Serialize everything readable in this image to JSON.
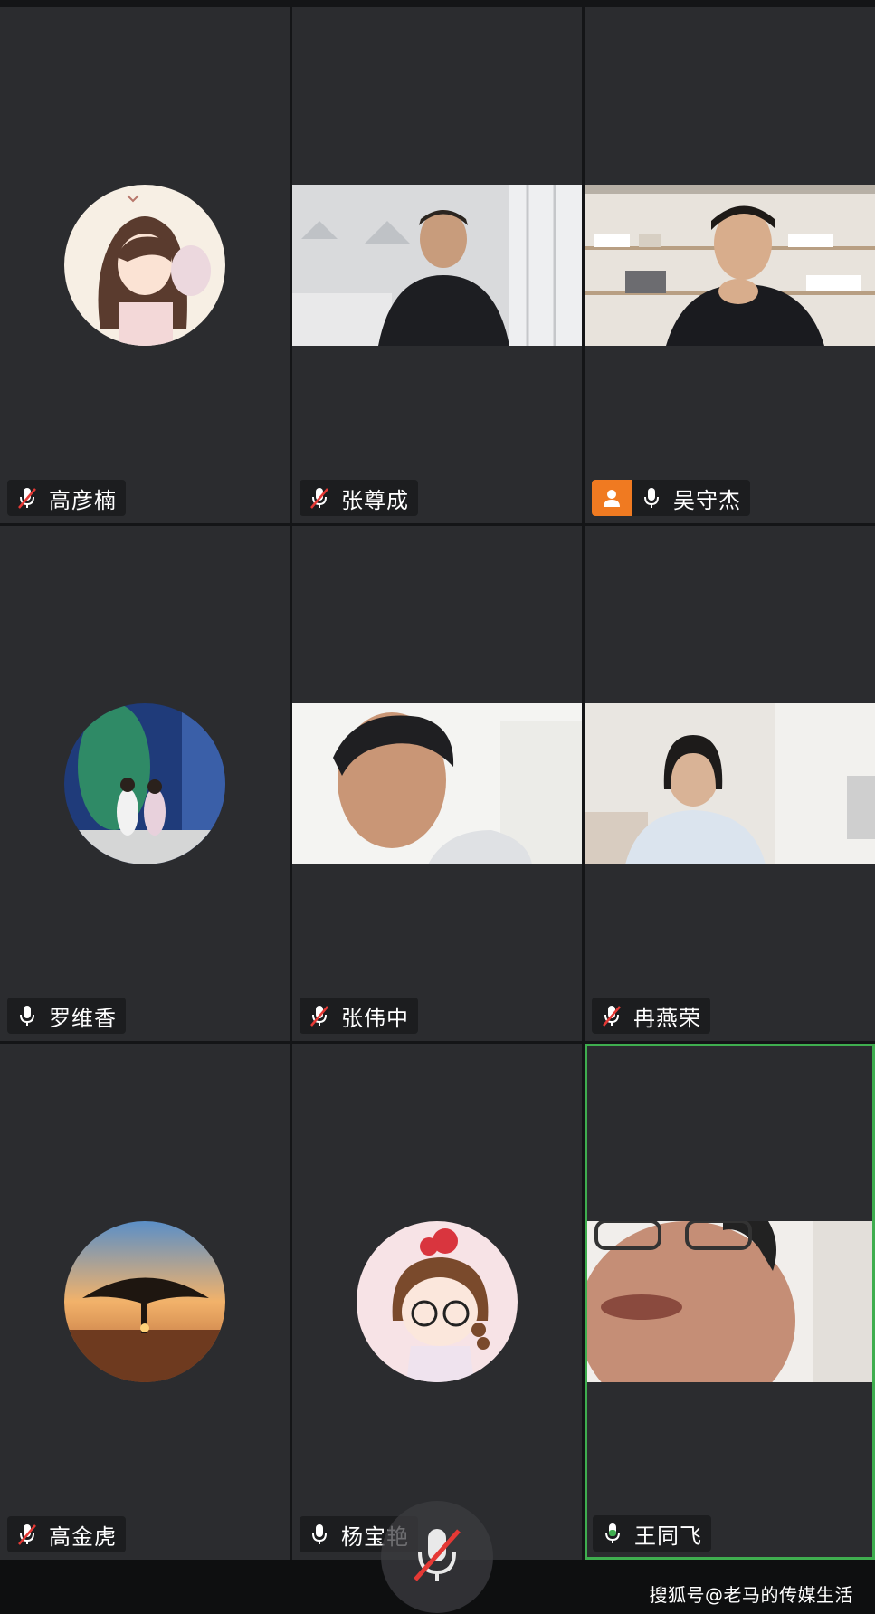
{
  "participants": [
    {
      "name": "高彦楠",
      "mic": "muted"
    },
    {
      "name": "张尊成",
      "mic": "muted"
    },
    {
      "name": "吴守杰",
      "mic": "on",
      "host": true
    },
    {
      "name": "罗维香",
      "mic": "on"
    },
    {
      "name": "张伟中",
      "mic": "muted"
    },
    {
      "name": "冉燕荣",
      "mic": "muted"
    },
    {
      "name": "高金虎",
      "mic": "muted"
    },
    {
      "name": "杨宝艳",
      "mic": "on"
    },
    {
      "name": "王同飞",
      "mic": "speaking",
      "active_speaker": true
    }
  ],
  "toolbar": {
    "mute_icon": "microphone-muted-icon"
  },
  "watermark": "搜狐号@老马的传媒生活",
  "colors": {
    "tile_bg": "#2b2c2f",
    "active_border": "#3fae4f",
    "host_badge": "#f07a21",
    "speaking_mic": "#3fae4f"
  }
}
